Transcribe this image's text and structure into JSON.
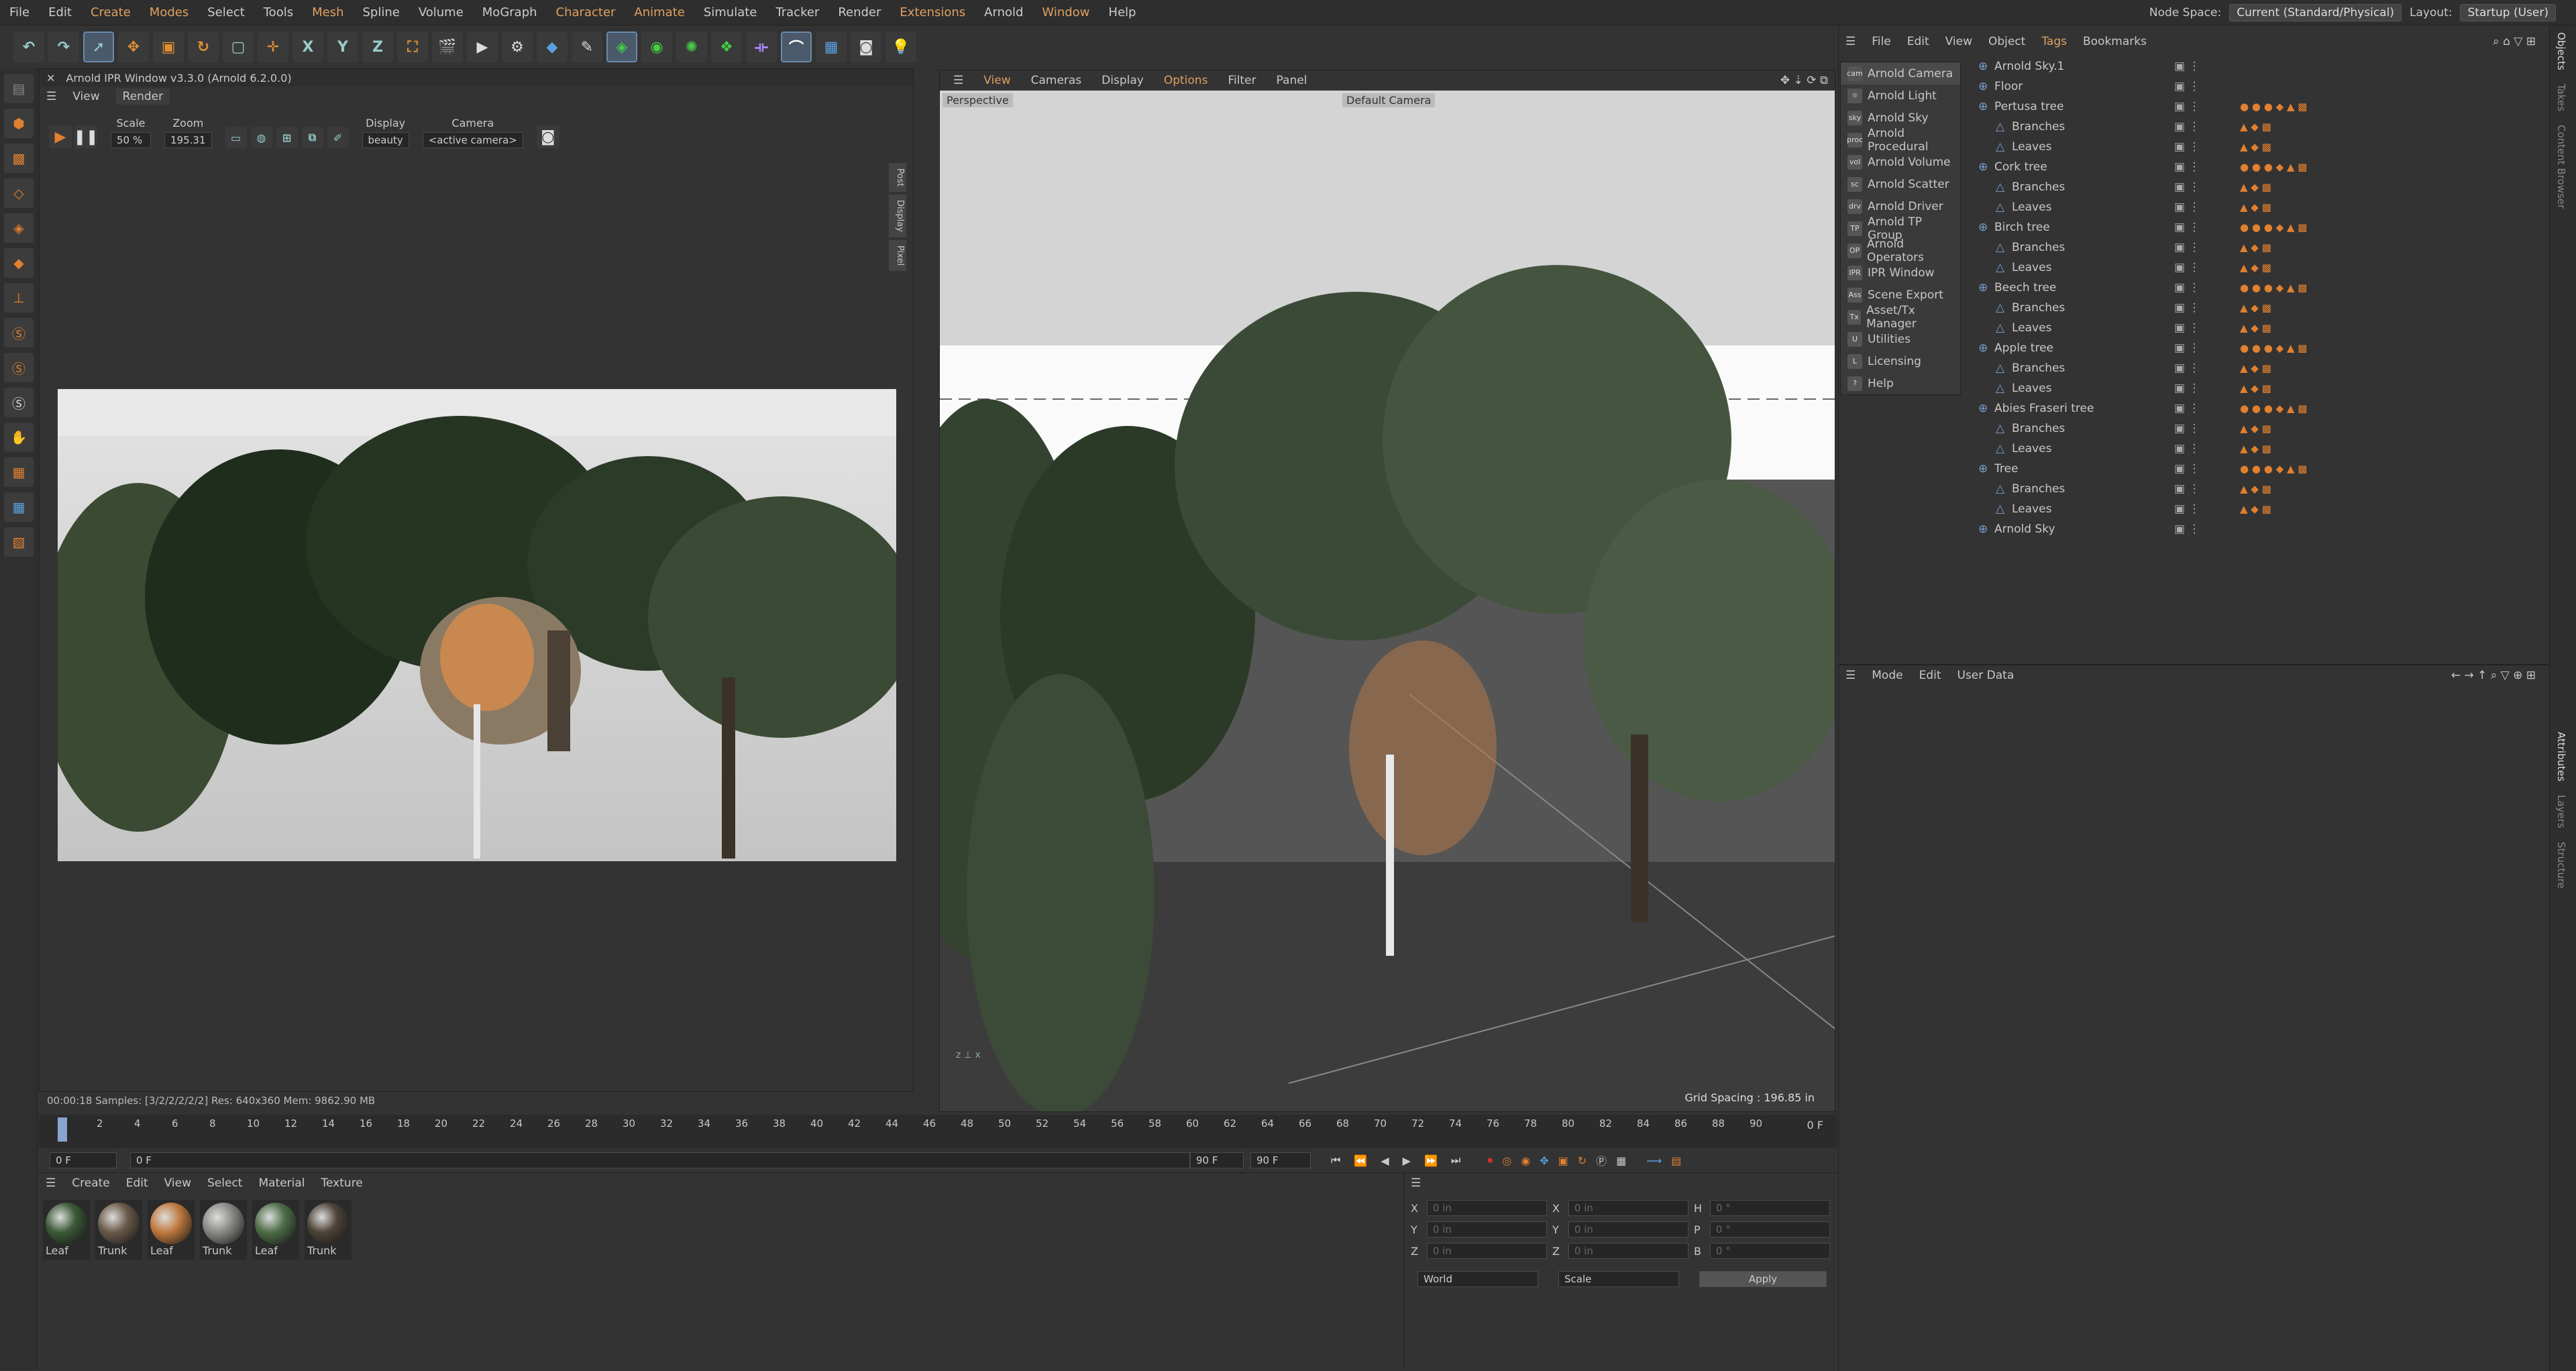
{
  "menubar": {
    "items": [
      "File",
      "Edit",
      "Create",
      "Modes",
      "Select",
      "Tools",
      "Mesh",
      "Spline",
      "Volume",
      "MoGraph",
      "Character",
      "Animate",
      "Simulate",
      "Tracker",
      "Render",
      "Extensions",
      "Arnold",
      "Window",
      "Help"
    ],
    "node_space_label": "Node Space:",
    "node_space_value": "Current (Standard/Physical)",
    "layout_label": "Layout:",
    "layout_value": "Startup (User)"
  },
  "toolbar": {
    "axes": [
      "X",
      "Y",
      "Z"
    ]
  },
  "ipr": {
    "title": "Arnold IPR Window v3.3.0 (Arnold 6.2.0.0)",
    "menu": [
      "View",
      "Render"
    ],
    "scale_label": "Scale",
    "scale_value": "50 %",
    "zoom_label": "Zoom",
    "zoom_value": "195.31",
    "display_label": "Display",
    "display_value": "beauty",
    "camera_label": "Camera",
    "camera_value": "<active camera>",
    "status": "00:00:18  Samples: [3/2/2/2/2/2]  Res: 640x360  Mem: 9862.90 MB",
    "side_tabs": [
      "Post",
      "Display",
      "Pixel"
    ]
  },
  "viewport": {
    "menu": [
      "View",
      "Cameras",
      "Display",
      "Options",
      "Filter",
      "Panel"
    ],
    "label_perspective": "Perspective",
    "label_camera": "Default Camera",
    "grid_spacing": "Grid Spacing : 196.85 in"
  },
  "timeline": {
    "ticks": [
      "0",
      "2",
      "4",
      "6",
      "8",
      "10",
      "12",
      "14",
      "16",
      "18",
      "20",
      "22",
      "24",
      "26",
      "28",
      "30",
      "32",
      "34",
      "36",
      "38",
      "40",
      "42",
      "44",
      "46",
      "48",
      "50",
      "52",
      "54",
      "56",
      "58",
      "60",
      "62",
      "64",
      "66",
      "68",
      "70",
      "72",
      "74",
      "76",
      "78",
      "80",
      "82",
      "84",
      "86",
      "88",
      "90"
    ],
    "frame_right": "0 F"
  },
  "transport": {
    "start": "0 F",
    "current": "0 F",
    "end": "90 F",
    "end2": "90 F"
  },
  "materials": {
    "menu": [
      "Create",
      "Edit",
      "View",
      "Select",
      "Material",
      "Texture"
    ],
    "items": [
      {
        "name": "Leaf",
        "color": "#3c5a38"
      },
      {
        "name": "Trunk",
        "color": "#6a5a4a"
      },
      {
        "name": "Leaf",
        "color": "#c07a40"
      },
      {
        "name": "Trunk",
        "color": "#8a8a86"
      },
      {
        "name": "Leaf",
        "color": "#4e6e48"
      },
      {
        "name": "Trunk",
        "color": "#4e4438"
      }
    ]
  },
  "coords": {
    "rows": [
      [
        "X",
        "0 in",
        "X",
        "0 in",
        "H",
        "0 °"
      ],
      [
        "Y",
        "0 in",
        "Y",
        "0 in",
        "P",
        "0 °"
      ],
      [
        "Z",
        "0 in",
        "Z",
        "0 in",
        "B",
        "0 °"
      ]
    ],
    "world": "World",
    "scale": "Scale",
    "apply": "Apply"
  },
  "objects": {
    "menu": [
      "File",
      "Edit",
      "View",
      "Object",
      "Tags",
      "Bookmarks"
    ],
    "arnold_menu": [
      "Arnold Camera",
      "Arnold Light",
      "Arnold Sky",
      "Arnold Procedural",
      "Arnold Volume",
      "Arnold Scatter",
      "Arnold Driver",
      "Arnold TP Group",
      "Arnold Operators",
      "IPR Window",
      "Scene Export",
      "Asset/Tx Manager",
      "Utilities",
      "Licensing",
      "Help"
    ],
    "arnold_icons": [
      "cam",
      "☼",
      "sky",
      "proc",
      "vol",
      "sc",
      "drv",
      "TP",
      "OP",
      "IPR",
      "Ass",
      "Tx",
      "U",
      "L",
      "?"
    ],
    "tree": [
      {
        "name": "Arnold Sky.1",
        "lvl": 0
      },
      {
        "name": "Floor",
        "lvl": 0
      },
      {
        "name": "Pertusa tree",
        "lvl": 0
      },
      {
        "name": "Branches",
        "lvl": 1
      },
      {
        "name": "Leaves",
        "lvl": 1
      },
      {
        "name": "Cork tree",
        "lvl": 0
      },
      {
        "name": "Branches",
        "lvl": 1
      },
      {
        "name": "Leaves",
        "lvl": 1
      },
      {
        "name": "Birch tree",
        "lvl": 0
      },
      {
        "name": "Branches",
        "lvl": 1
      },
      {
        "name": "Leaves",
        "lvl": 1
      },
      {
        "name": "Beech tree",
        "lvl": 0
      },
      {
        "name": "Branches",
        "lvl": 1
      },
      {
        "name": "Leaves",
        "lvl": 1
      },
      {
        "name": "Apple tree",
        "lvl": 0
      },
      {
        "name": "Branches",
        "lvl": 1
      },
      {
        "name": "Leaves",
        "lvl": 1
      },
      {
        "name": "Abies Fraseri tree",
        "lvl": 0
      },
      {
        "name": "Branches",
        "lvl": 1
      },
      {
        "name": "Leaves",
        "lvl": 1
      },
      {
        "name": "Tree",
        "lvl": 0
      },
      {
        "name": "Branches",
        "lvl": 1
      },
      {
        "name": "Leaves",
        "lvl": 1
      },
      {
        "name": "Arnold Sky",
        "lvl": 0
      }
    ]
  },
  "attributes": {
    "menu": [
      "Mode",
      "Edit",
      "User Data"
    ]
  },
  "right_tabs": [
    "Objects",
    "Takes",
    "Content Browser",
    "Attributes",
    "Layers",
    "Structure"
  ]
}
